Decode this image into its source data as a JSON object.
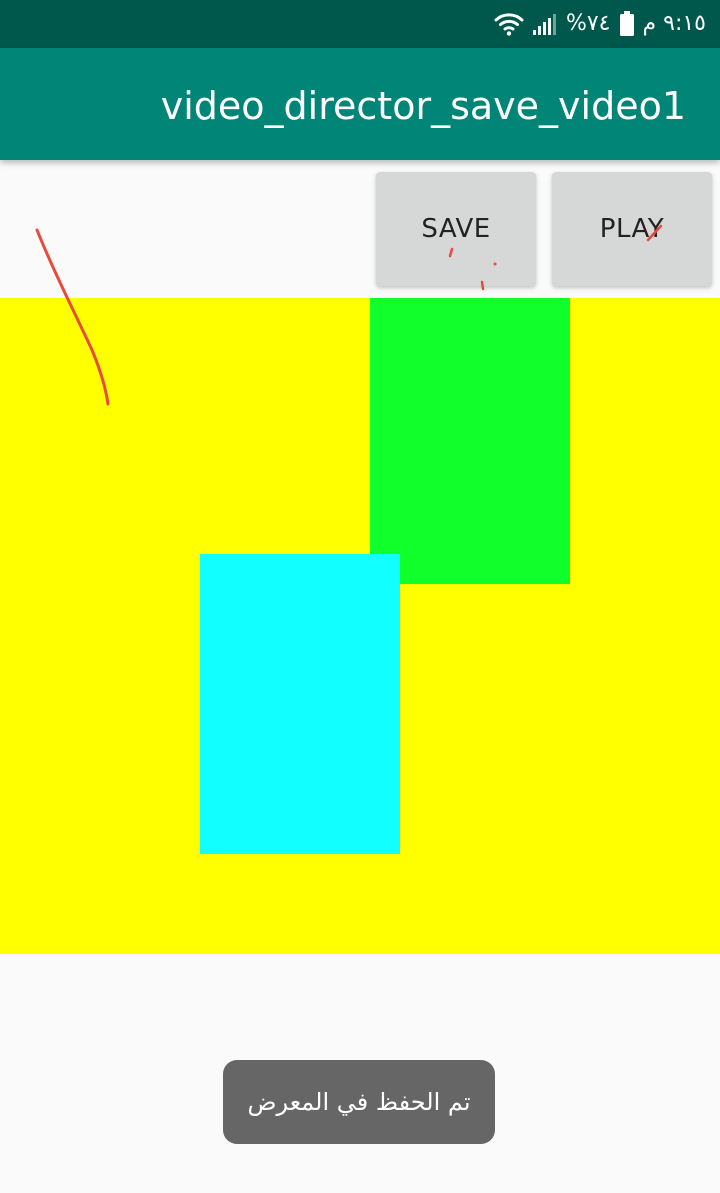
{
  "status_bar": {
    "time": "٩:١٥ م",
    "battery": "%٧٤",
    "icons": [
      "wifi-icon",
      "signal-icon",
      "battery-icon"
    ]
  },
  "app_bar": {
    "title": "video_director_save_video1"
  },
  "toolbar": {
    "save_label": "SAVE",
    "play_label": "PLAY"
  },
  "canvas": {
    "background": "#ffff00",
    "shapes": [
      {
        "name": "green-rectangle",
        "color": "#11ff2a"
      },
      {
        "name": "cyan-rectangle",
        "color": "#11ffff"
      }
    ],
    "stroke_color": "#e84a3c"
  },
  "toast": {
    "message": "تم الحفظ في المعرض"
  },
  "colors": {
    "status_bar": "#00574b",
    "app_bar": "#008577",
    "button": "#d6d7d7",
    "toast": "#666666"
  }
}
